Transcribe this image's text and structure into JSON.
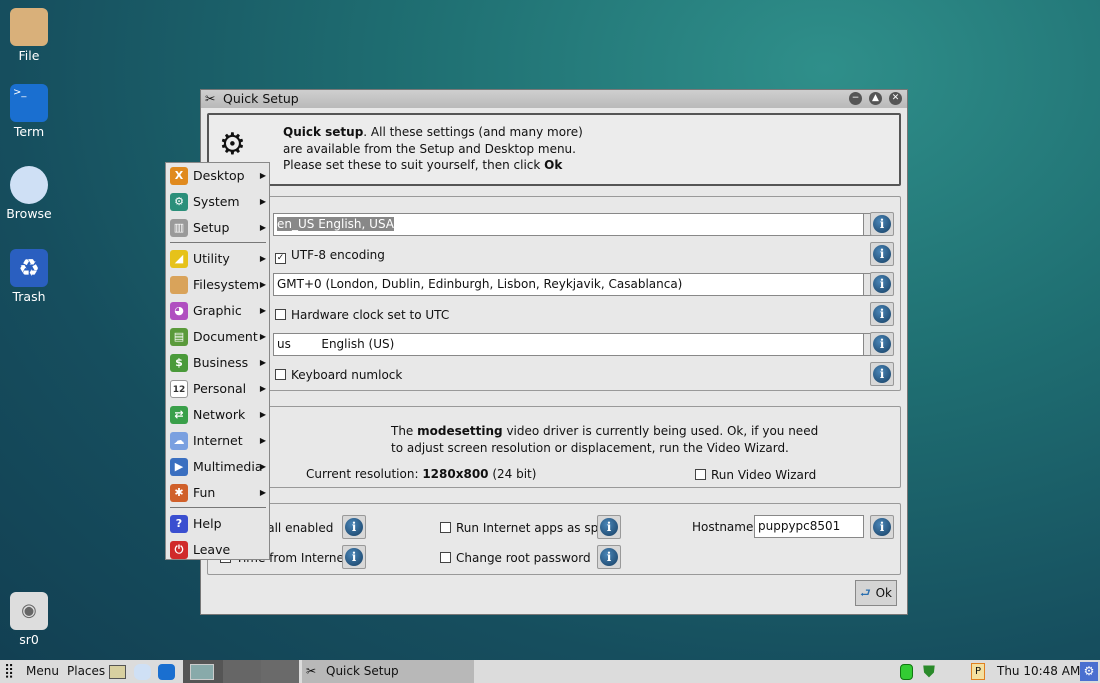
{
  "desktop": {
    "icons": [
      {
        "label": "File",
        "icon": "folder-home-icon"
      },
      {
        "label": "Term",
        "icon": "terminal-icon"
      },
      {
        "label": "Browse",
        "icon": "cloud-icon"
      },
      {
        "label": "Trash",
        "icon": "trash-icon"
      },
      {
        "label": "sr0",
        "icon": "cdrom-icon"
      }
    ]
  },
  "window": {
    "title": "Quick Setup",
    "intro_bold": "Quick setup",
    "intro_rest": ". All these settings (and many more) are available from the Setup and Desktop menu. Please set these to suit yourself, then click ",
    "intro_ok": "Ok",
    "locale": "en_US  English, USA",
    "utf8": "UTF-8 encoding",
    "timezone": "GMT+0 (London, Dublin, Edinburgh, Lisbon, Reykjavik, Casablanca)",
    "hwclock": "Hardware clock set to UTC",
    "keyboard": "us        English (US)",
    "numlock": "Keyboard numlock",
    "video_pre": "The ",
    "video_bold": "modesetting",
    "video_rest": " video driver is currently being used. Ok, if you need to adjust screen resolution or displacement, run the Video Wizard.",
    "res_label": "Current resolution: ",
    "res_value": "1280x800",
    "res_bits": " (24 bit)",
    "video_wizard": "Run Video Wizard",
    "firewall": "Firewall enabled",
    "time_internet": "Time from Internet",
    "spot": "Run Internet apps as spot",
    "root_pw": "Change root password",
    "hostname_label": "Hostname:",
    "hostname": "puppypc8501",
    "ok": "Ok"
  },
  "menu": {
    "items": [
      {
        "label": "Desktop",
        "color": "#e08a1e",
        "glyph": "X"
      },
      {
        "label": "System",
        "color": "#2b8f7a",
        "glyph": "⚙"
      },
      {
        "label": "Setup",
        "color": "#9a9a9a",
        "glyph": "▥"
      },
      {
        "label": "Utility",
        "color": "#e6c21a",
        "glyph": "◢"
      },
      {
        "label": "Filesystem",
        "color": "#d9a35a",
        "glyph": ""
      },
      {
        "label": "Graphic",
        "color": "#b04fc0",
        "glyph": "◕"
      },
      {
        "label": "Document",
        "color": "#5a9a3a",
        "glyph": "▤"
      },
      {
        "label": "Business",
        "color": "#4a9a3a",
        "glyph": "$"
      },
      {
        "label": "Personal",
        "color": "#ffffff",
        "glyph": "12"
      },
      {
        "label": "Network",
        "color": "#3aa04a",
        "glyph": "⇄"
      },
      {
        "label": "Internet",
        "color": "#7aa0e0",
        "glyph": "☁"
      },
      {
        "label": "Multimedia",
        "color": "#3a6fc0",
        "glyph": "▶"
      },
      {
        "label": "Fun",
        "color": "#d0602a",
        "glyph": "✱"
      },
      {
        "label": "Help",
        "color": "#3a4fd0",
        "glyph": "?"
      },
      {
        "label": "Leave",
        "color": "#d02a2a",
        "glyph": "⏻"
      }
    ]
  },
  "taskbar": {
    "menu": "Menu",
    "places": "Places",
    "task": "Quick Setup",
    "clock": "Thu 10:48 AM"
  }
}
